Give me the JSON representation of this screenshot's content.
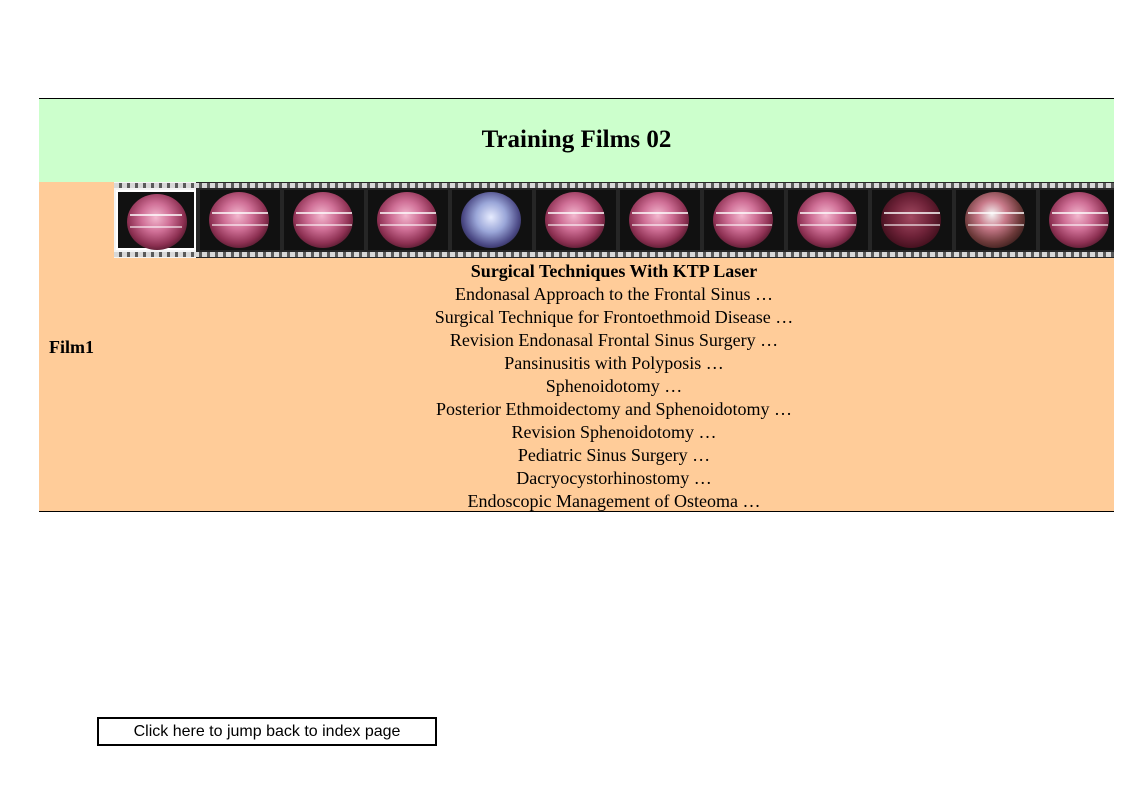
{
  "title": "Training Films 02",
  "row_label": "Film1",
  "film_strip": {
    "frames": [
      {
        "icon": "endoscopic-thumbnail-icon",
        "tone": "pink"
      },
      {
        "icon": "endoscopic-thumbnail-icon",
        "tone": "pink"
      },
      {
        "icon": "endoscopic-thumbnail-icon",
        "tone": "pink"
      },
      {
        "icon": "endoscopic-thumbnail-icon",
        "tone": "pink"
      },
      {
        "icon": "endoscopic-thumbnail-icon",
        "tone": "blue"
      },
      {
        "icon": "endoscopic-thumbnail-icon",
        "tone": "pink"
      },
      {
        "icon": "endoscopic-thumbnail-icon",
        "tone": "pink"
      },
      {
        "icon": "endoscopic-thumbnail-icon",
        "tone": "pink"
      },
      {
        "icon": "endoscopic-thumbnail-icon",
        "tone": "pink"
      },
      {
        "icon": "endoscopic-thumbnail-icon",
        "tone": "dark"
      },
      {
        "icon": "endoscopic-thumbnail-icon",
        "tone": "green"
      },
      {
        "icon": "endoscopic-thumbnail-icon",
        "tone": "pink"
      }
    ]
  },
  "films": {
    "heading": "Surgical Techniques With KTP Laser",
    "items": [
      "Endonasal Approach to the Frontal Sinus …",
      "Surgical Technique for Frontoethmoid Disease …",
      "Revision Endonasal Frontal Sinus Surgery …",
      "Pansinusitis with Polyposis …",
      "Sphenoidotomy …",
      "Posterior Ethmoidectomy and Sphenoidotomy …",
      "Revision Sphenoidotomy …",
      "Pediatric Sinus Surgery …",
      "Dacryocystorhinostomy …",
      "Endoscopic Management of Osteoma …"
    ]
  },
  "back_link": "Click here to jump back to index page",
  "colors": {
    "title_background": "#ccffcc",
    "body_background": "#ffcc99"
  }
}
